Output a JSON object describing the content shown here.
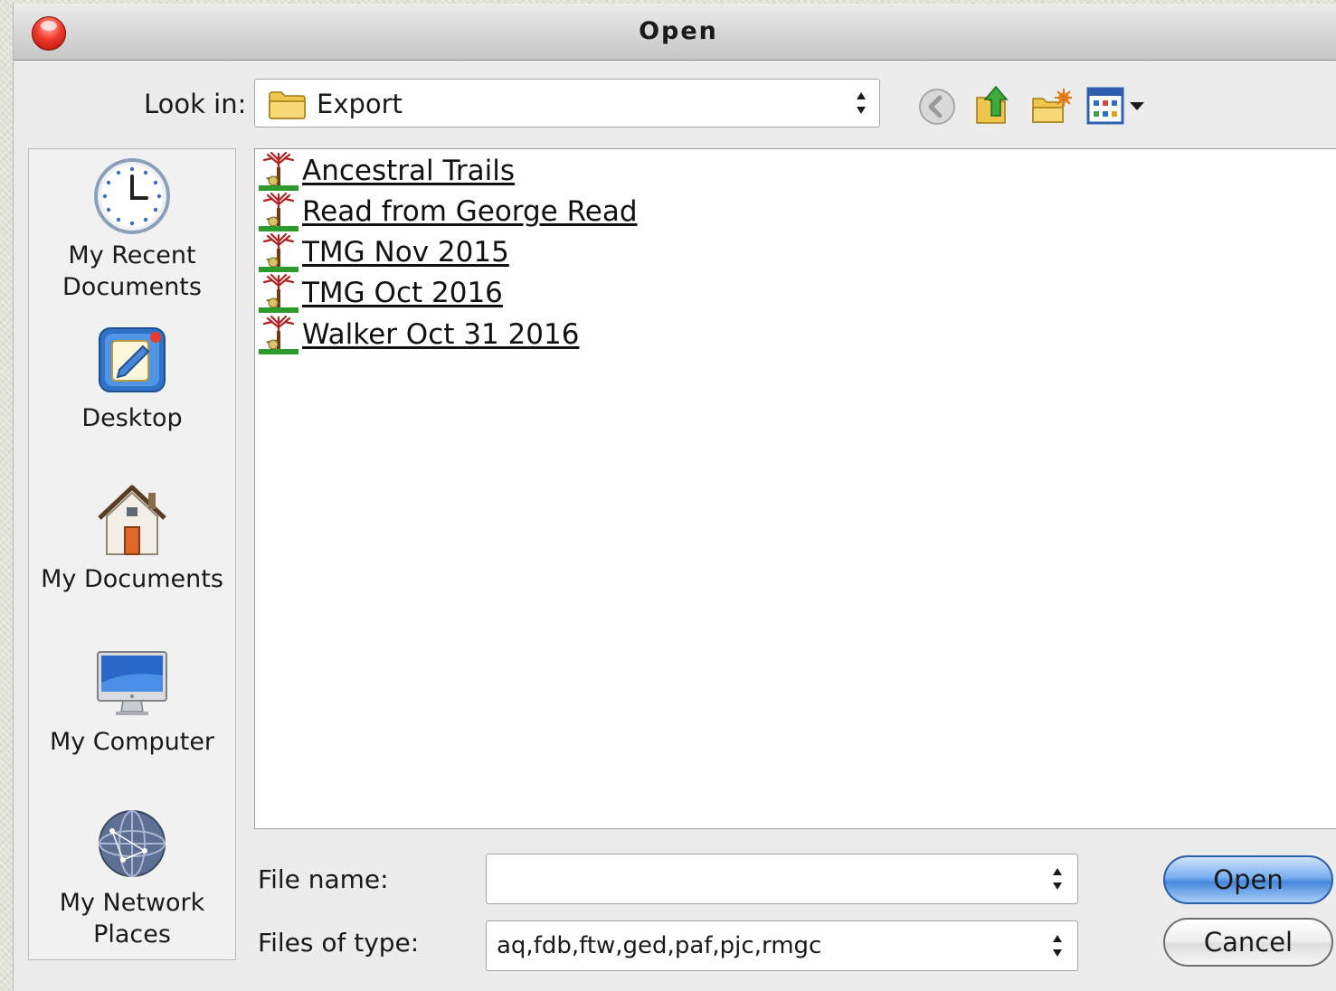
{
  "window": {
    "title": "Open"
  },
  "toolbar": {
    "look_in_label": "Look in:",
    "look_in_value": "Export",
    "icons": [
      "back-icon",
      "up-folder-icon",
      "new-folder-icon",
      "view-menu-icon"
    ]
  },
  "places": [
    {
      "label_line1": "My Recent",
      "label_line2": "Documents",
      "icon": "recent-documents-icon"
    },
    {
      "label_line1": "Desktop",
      "label_line2": "",
      "icon": "desktop-icon"
    },
    {
      "label_line1": "My Documents",
      "label_line2": "",
      "icon": "my-documents-icon"
    },
    {
      "label_line1": "My Computer",
      "label_line2": "",
      "icon": "my-computer-icon"
    },
    {
      "label_line1": "My Network",
      "label_line2": "Places",
      "icon": "network-places-icon"
    }
  ],
  "files": [
    {
      "name": "Ancestral Trails"
    },
    {
      "name": "Read from George Read"
    },
    {
      "name": "TMG Nov 2015"
    },
    {
      "name": "TMG Oct 2016"
    },
    {
      "name": "Walker Oct 31 2016"
    }
  ],
  "form": {
    "file_name_label": "File name:",
    "file_name_value": "",
    "files_of_type_label": "Files of type:",
    "files_of_type_value": "aq,fdb,ftw,ged,paf,pjc,rmgc"
  },
  "buttons": {
    "open": "Open",
    "cancel": "Cancel"
  },
  "colors": {
    "primary_button": "#4688de",
    "close_button": "#ef3b2b"
  }
}
